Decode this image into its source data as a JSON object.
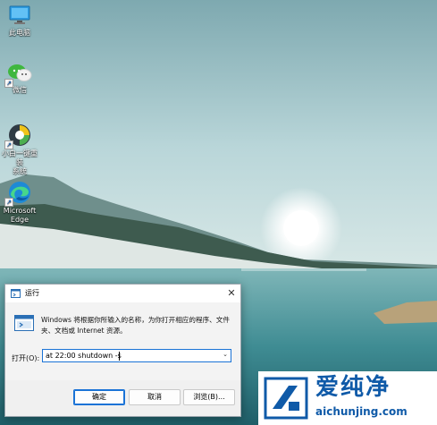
{
  "desktop": {
    "icons": [
      {
        "label": "此电脑",
        "icon": "computer-icon"
      },
      {
        "label": "微信",
        "icon": "wechat-icon"
      },
      {
        "label_line1": "小白一键重装",
        "label_line2": "系统",
        "icon": "reinstall-tool-icon"
      },
      {
        "label_line1": "Microsoft",
        "label_line2": "Edge",
        "icon": "edge-icon"
      }
    ]
  },
  "run_dialog": {
    "title": "运行",
    "close": "✕",
    "description": "Windows 将根据你所输入的名称，为你打开相应的程序、文件夹、文档或 Internet 资源。",
    "open_label": "打开(O):",
    "command_value": "at 22:00 shutdown -s",
    "buttons": {
      "ok": "确定",
      "cancel": "取消",
      "browse": "浏览(B)..."
    },
    "accent_color": "#1a73d6"
  },
  "watermark": {
    "title": "爱纯净",
    "url": "aichunjing.com",
    "color": "#0f5aa8"
  }
}
